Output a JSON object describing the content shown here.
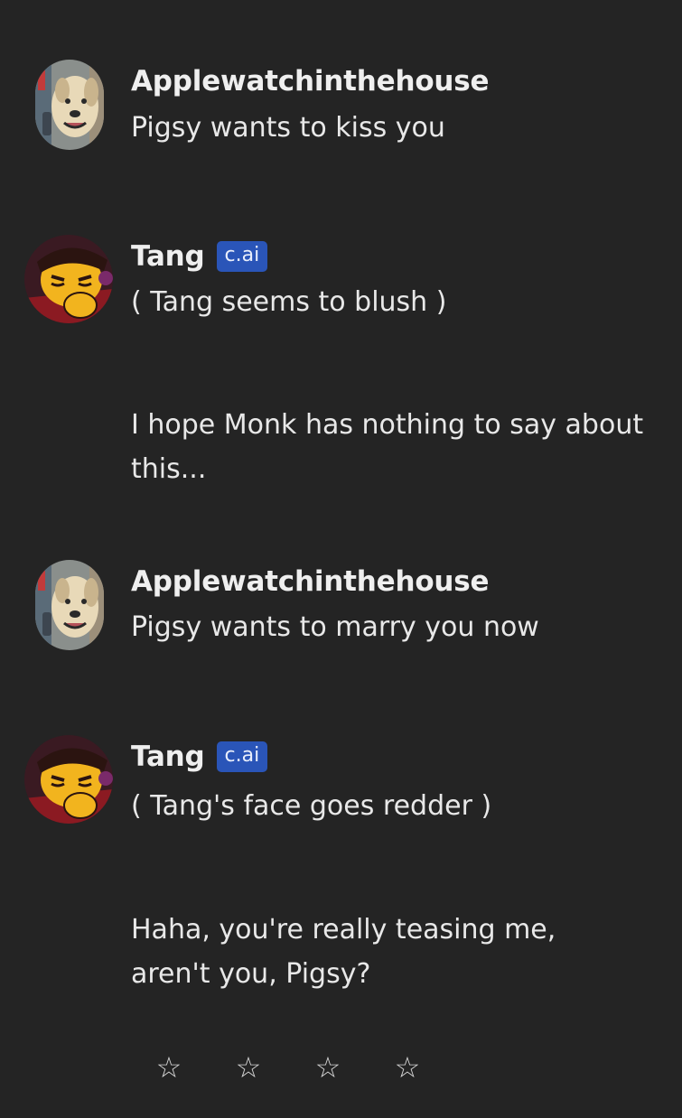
{
  "messages": [
    {
      "author": "Applewatchinthehouse",
      "text": "Pigsy wants to kiss you",
      "avatar_icon": "dog-avatar-icon"
    },
    {
      "author": "Tang",
      "badge": "c.ai",
      "text": "( Tang seems to blush )",
      "text2": "I hope Monk has nothing to say about this...",
      "avatar_icon": "tang-character-avatar-icon"
    },
    {
      "author": "Applewatchinthehouse",
      "text": "Pigsy wants to marry you now",
      "avatar_icon": "dog-avatar-icon"
    },
    {
      "author": "Tang",
      "badge": "c.ai",
      "text": "( Tang's face goes redder )",
      "text2": "Haha, you're really teasing me, aren't you, Pigsy?",
      "avatar_icon": "tang-character-avatar-icon"
    }
  ],
  "rating": {
    "stars": [
      "☆",
      "☆",
      "☆",
      "☆"
    ],
    "star_icon": "star-outline-icon"
  },
  "colors": {
    "background": "#242424",
    "text": "#ececec",
    "badge": "#2a55b8"
  }
}
